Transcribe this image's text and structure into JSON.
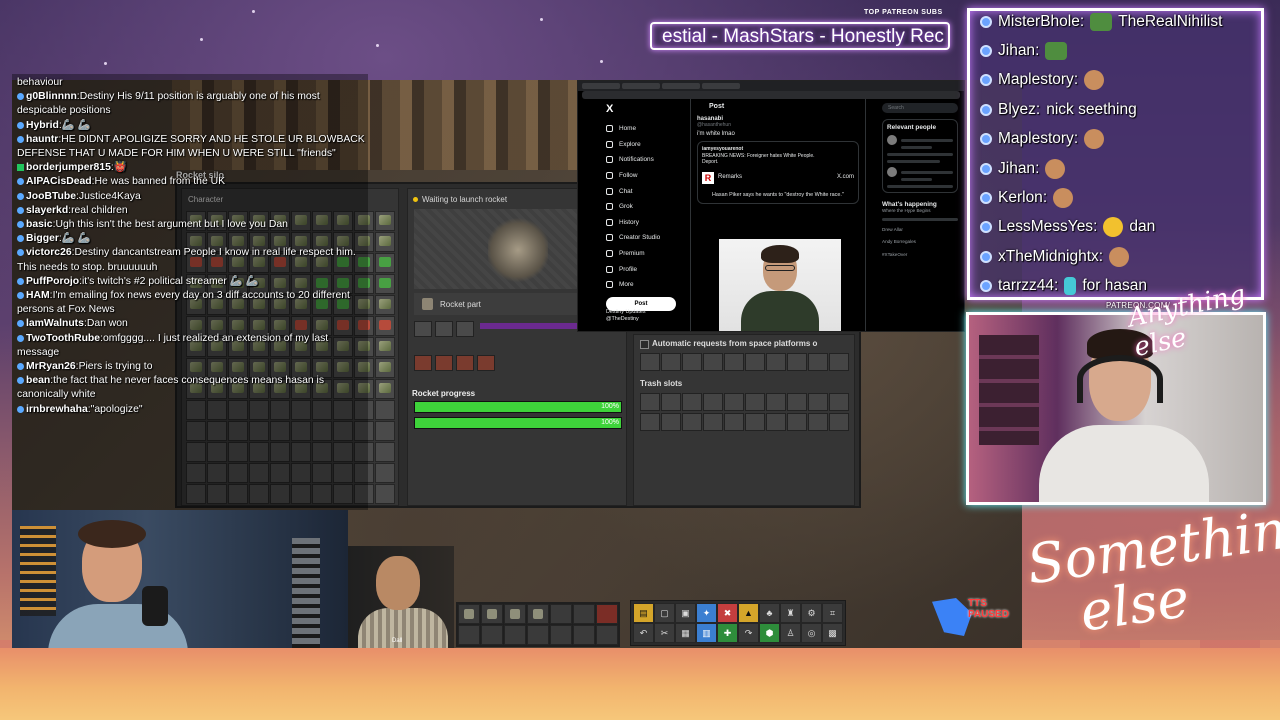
{
  "overlay": {
    "top_subs_label": "TOP PATREON SUBS",
    "marquee_text": "estial - MashStars - Honestly Rec",
    "patreon_url": "PATREON.COM/",
    "script_small": "Anything else",
    "script_big_line1": "Something",
    "script_big_line2": "else",
    "tts_label_1": "TTS",
    "tts_label_2": "PAUSED"
  },
  "chat": [
    {
      "user": "",
      "text": "behaviour"
    },
    {
      "user": "g0Blinnnn",
      "text": "Destiny His 9/11 position is arguably one of his most despicable positions"
    },
    {
      "user": "Hybrid",
      "text": "🦾 🦾"
    },
    {
      "user": "hauntr",
      "text": "HE DIDNT APOLIGIZE SORRY AND HE STOLE UR BLOWBACK DEFENSE THAT U MADE FOR HIM WHEN U WERE STILL \"friends\""
    },
    {
      "user": "borderjumper815",
      "text": "👹"
    },
    {
      "user": "AIPACisDead",
      "text": "He was banned from the UK"
    },
    {
      "user": "JooBTube",
      "text": "Justice4Kaya"
    },
    {
      "user": "slayerkd",
      "text": "real children"
    },
    {
      "user": "basic",
      "text": "Ugh this isn't the best argument but I love you Dan"
    },
    {
      "user": "Bigger",
      "text": "🦾 🦾"
    },
    {
      "user": "victorc26",
      "text": "Destiny dancantstream People I know in real life respect him. This needs to stop. bruuuuuuh"
    },
    {
      "user": "PuffPorojo",
      "text": "it's twitch's #2 political streamer 🦾 🦾"
    },
    {
      "user": "HAM",
      "text": "I'm emailing fox news every day on 3 diff accounts to 20 different persons at Fox News"
    },
    {
      "user": "lamWalnuts",
      "text": "Dan won"
    },
    {
      "user": "TwoToothRube",
      "text": "omfgggg.... I just realized an extension of my last message"
    },
    {
      "user": "MrRyan26",
      "text": "Piers is trying to"
    },
    {
      "user": "bean",
      "text": "the fact that he never faces consequences means hasan is canonically white"
    },
    {
      "user": "irnbrewhaha",
      "text": "\"apologize\""
    }
  ],
  "alerts": [
    {
      "user": "MisterBhole",
      "text": "TheRealNihilist"
    },
    {
      "user": "Jihan",
      "text": ""
    },
    {
      "user": "Maplestory",
      "text": ""
    },
    {
      "user": "Blyez",
      "text": "nick seething"
    },
    {
      "user": "Maplestory",
      "text": ""
    },
    {
      "user": "Jihan",
      "text": ""
    },
    {
      "user": "Kerlon",
      "text": ""
    },
    {
      "user": "LessMessYes",
      "text": "dan"
    },
    {
      "user": "xTheMidnightx",
      "text": ""
    },
    {
      "user": "tarrzz44",
      "text": "for hasan"
    }
  ],
  "game": {
    "silo_title": "Rocket silo",
    "character_label": "Character",
    "status": "Waiting to launch rocket",
    "rocket_part": "Rocket part",
    "rocket_progress_label": "Rocket progress",
    "progress_1": "100%",
    "progress_2": "100%",
    "auto_requests": "Automatic requests from space platforms o",
    "trash_slots": "Trash slots",
    "guest_name": "Dall"
  },
  "twitter": {
    "logo": "X",
    "nav": [
      "Home",
      "Explore",
      "Notifications",
      "Follow",
      "Chat",
      "Grok",
      "History",
      "Creator Studio",
      "Premium",
      "Profile",
      "More"
    ],
    "post_button": "Post",
    "profile_name": "Destiny Updates",
    "profile_handle": "@TheDestiny",
    "header": "Post",
    "author": "hasanabi",
    "author_handle": "@hasanthehun",
    "tweet_text": "i'm white lmao",
    "quote_author": "iamyesyouarenot",
    "quote_text": "BREAKING NEWS: Foreigner hates White People.",
    "quote_sub": "Deport.",
    "card_source": "Remarks",
    "card_domain": "X.com",
    "card_text": "Hasan Piker says he wants to \"destroy the White race.\"",
    "search_placeholder": "Search",
    "relevant_people": "Relevant people",
    "whats_happening": "What's happening",
    "trend_1": "Where the Hype Begins",
    "trend_2": "Drew Allar",
    "trend_3": "Andy Borregales",
    "trend_4": "#XTakeOver"
  }
}
